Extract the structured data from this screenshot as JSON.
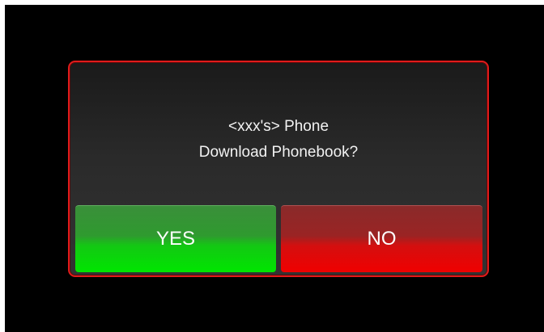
{
  "dialog": {
    "line1": "<xxx's> Phone",
    "line2": "Download Phonebook?"
  },
  "buttons": {
    "yes_label": "YES",
    "no_label": "NO"
  },
  "colors": {
    "background": "#000000",
    "dialog_border": "#e01b1b",
    "yes_button": "#00e600",
    "no_button": "#f00000",
    "text": "#ffffff"
  }
}
